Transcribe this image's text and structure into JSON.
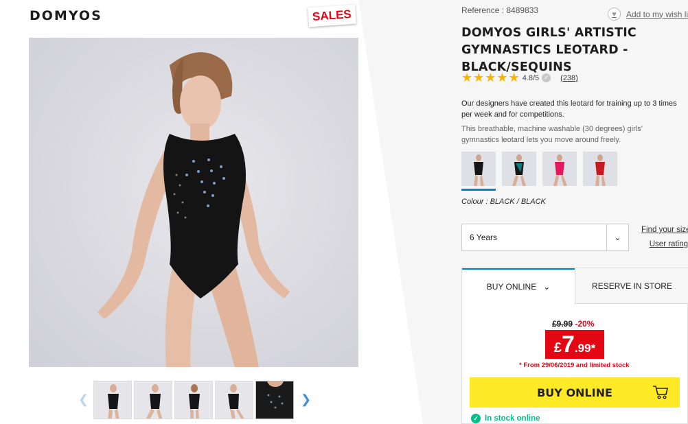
{
  "brand": {
    "logo_text": "DOMYOS"
  },
  "sales_badge": "SALES",
  "product": {
    "reference_label": "Reference : 8489833",
    "wishlist_label": "Add to my wish list",
    "title": "DOMYOS GIRLS' ARTISTIC GYMNASTICS LEOTARD - BLACK/SEQUINS",
    "rating": {
      "stars": 5,
      "value_text": "4.8/5",
      "review_count_text": "(238)"
    },
    "description_1": "Our designers have created this leotard for training up to 3 times per week and for competitions.",
    "description_2": "This breathable, machine washable (30 degrees) girls' gymnastics leotard lets you move around freely.",
    "colour_label": "Colour : BLACK / BLACK",
    "swatches": [
      {
        "name": "black",
        "color": "#151515"
      },
      {
        "name": "black-teal",
        "color": "#0e7b80"
      },
      {
        "name": "pink",
        "color": "#e5195e"
      },
      {
        "name": "red",
        "color": "#c51a22"
      }
    ]
  },
  "gallery": {
    "thumbnail_count": 5
  },
  "size": {
    "selected": "6 Years",
    "find_size_link": "Find your size",
    "user_rating_link": "User rating"
  },
  "purchase": {
    "tab_online": "BUY ONLINE",
    "tab_store": "RESERVE IN STORE",
    "old_price": "£9.99",
    "discount": "-20%",
    "price_currency": "£",
    "price_int": "7",
    "price_dec": ".99*",
    "price_note": "* From 29/06/2019 and limited stock",
    "buy_button": "BUY ONLINE",
    "stock_status": "In stock online"
  },
  "colors": {
    "accent": "#0082c3",
    "sale_red": "#e30613",
    "buy_yellow": "#ffea28",
    "stock_green": "#02be8a"
  }
}
